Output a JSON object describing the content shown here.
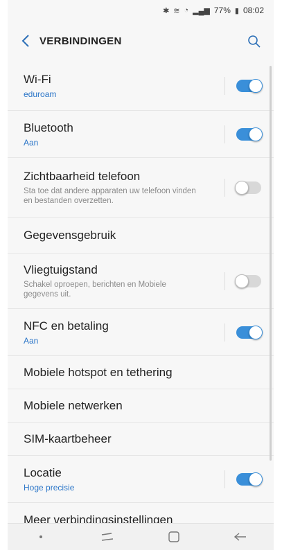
{
  "status": {
    "battery": "77%",
    "time": "08:02"
  },
  "header": {
    "title": "VERBINDINGEN"
  },
  "items": [
    {
      "title": "Wi-Fi",
      "sub": "eduroam",
      "toggle": "on"
    },
    {
      "title": "Bluetooth",
      "sub": "Aan",
      "toggle": "on"
    },
    {
      "title": "Zichtbaarheid telefoon",
      "desc": "Sta toe dat andere apparaten uw telefoon vinden en bestanden overzetten.",
      "toggle": "off"
    },
    {
      "title": "Gegevensgebruik"
    },
    {
      "title": "Vliegtuigstand",
      "desc": "Schakel oproepen, berichten en Mobiele gegevens uit.",
      "toggle": "off"
    },
    {
      "title": "NFC en betaling",
      "sub": "Aan",
      "toggle": "on"
    },
    {
      "title": "Mobiele hotspot en tethering"
    },
    {
      "title": "Mobiele netwerken"
    },
    {
      "title": "SIM-kaartbeheer"
    },
    {
      "title": "Locatie",
      "sub": "Hoge precisie",
      "toggle": "on"
    },
    {
      "title": "Meer verbindingsinstellingen"
    }
  ],
  "colors": {
    "accent": "#3a8fd9",
    "subtitle": "#2c76c8"
  }
}
